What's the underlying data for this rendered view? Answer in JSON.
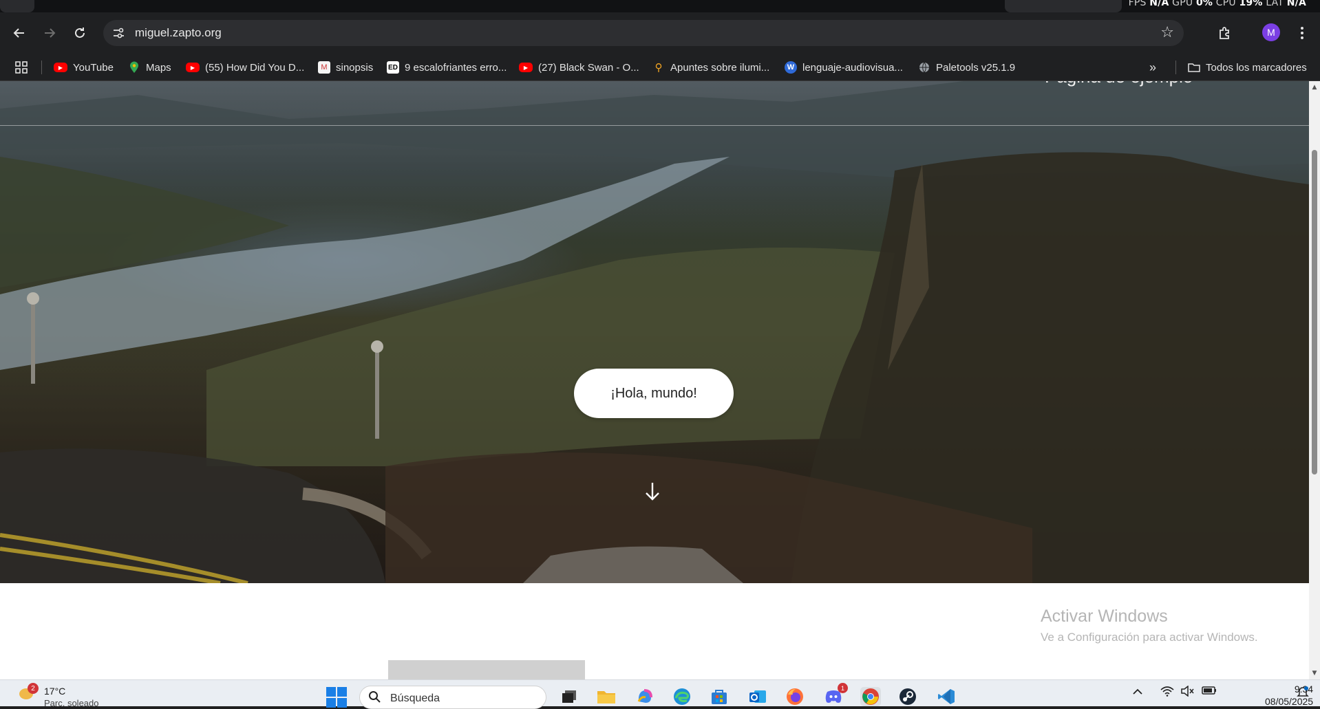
{
  "perf_overlay": {
    "fps_label": "FPS",
    "fps_value": "N/A",
    "gpu_label": "GPU",
    "gpu_value": "0%",
    "cpu_label": "CPU",
    "cpu_value": "19%",
    "lat_label": "LAT",
    "lat_value": "N/A"
  },
  "toolbar": {
    "back_icon": "arrow-left-icon",
    "forward_icon": "arrow-right-icon",
    "reload_icon": "reload-icon",
    "url": "miguel.zapto.org",
    "bookmark_star_icon": "star-icon",
    "extensions_icon": "puzzle-icon",
    "profile_initial": "M",
    "menu_icon": "kebab-icon"
  },
  "bookmarks": {
    "items": [
      {
        "label": "YouTube",
        "icon": "youtube-icon"
      },
      {
        "label": "Maps",
        "icon": "maps-pin-icon"
      },
      {
        "label": "(55) How Did You D...",
        "icon": "youtube-icon"
      },
      {
        "label": "sinopsis",
        "icon": "site-icon"
      },
      {
        "label": "9 escalofriantes erro...",
        "icon": "ed-icon"
      },
      {
        "label": "(27) Black Swan - O...",
        "icon": "youtube-icon"
      },
      {
        "label": "Apuntes sobre ilumi...",
        "icon": "figure-icon"
      },
      {
        "label": "lenguaje-audiovisua...",
        "icon": "wordpress-icon"
      },
      {
        "label": "Paletools v25.1.9",
        "icon": "globe-icon"
      }
    ],
    "all_bookmarks_label": "Todos los marcadores"
  },
  "page": {
    "hero_title": "Página de ejemplo",
    "hello_button": "¡Hola, mundo!",
    "scroll_down_icon": "arrow-down-icon"
  },
  "watermark": {
    "title": "Activar Windows",
    "subtitle": "Ve a Configuración para activar Windows."
  },
  "taskbar": {
    "weather_badge": "2",
    "temperature": "17°C",
    "weather_desc": "Parc. soleado",
    "search_placeholder": "Búsqueda",
    "discord_badge": "1",
    "time": "9:34",
    "date": "08/05/2025"
  },
  "colors": {
    "chrome_bg": "#1f2022",
    "omnibox_bg": "#2d2e31",
    "avatar": "#7b3fe4",
    "taskbar_bg": "#eaeef3",
    "windows_blue": "#1a7fe6"
  }
}
